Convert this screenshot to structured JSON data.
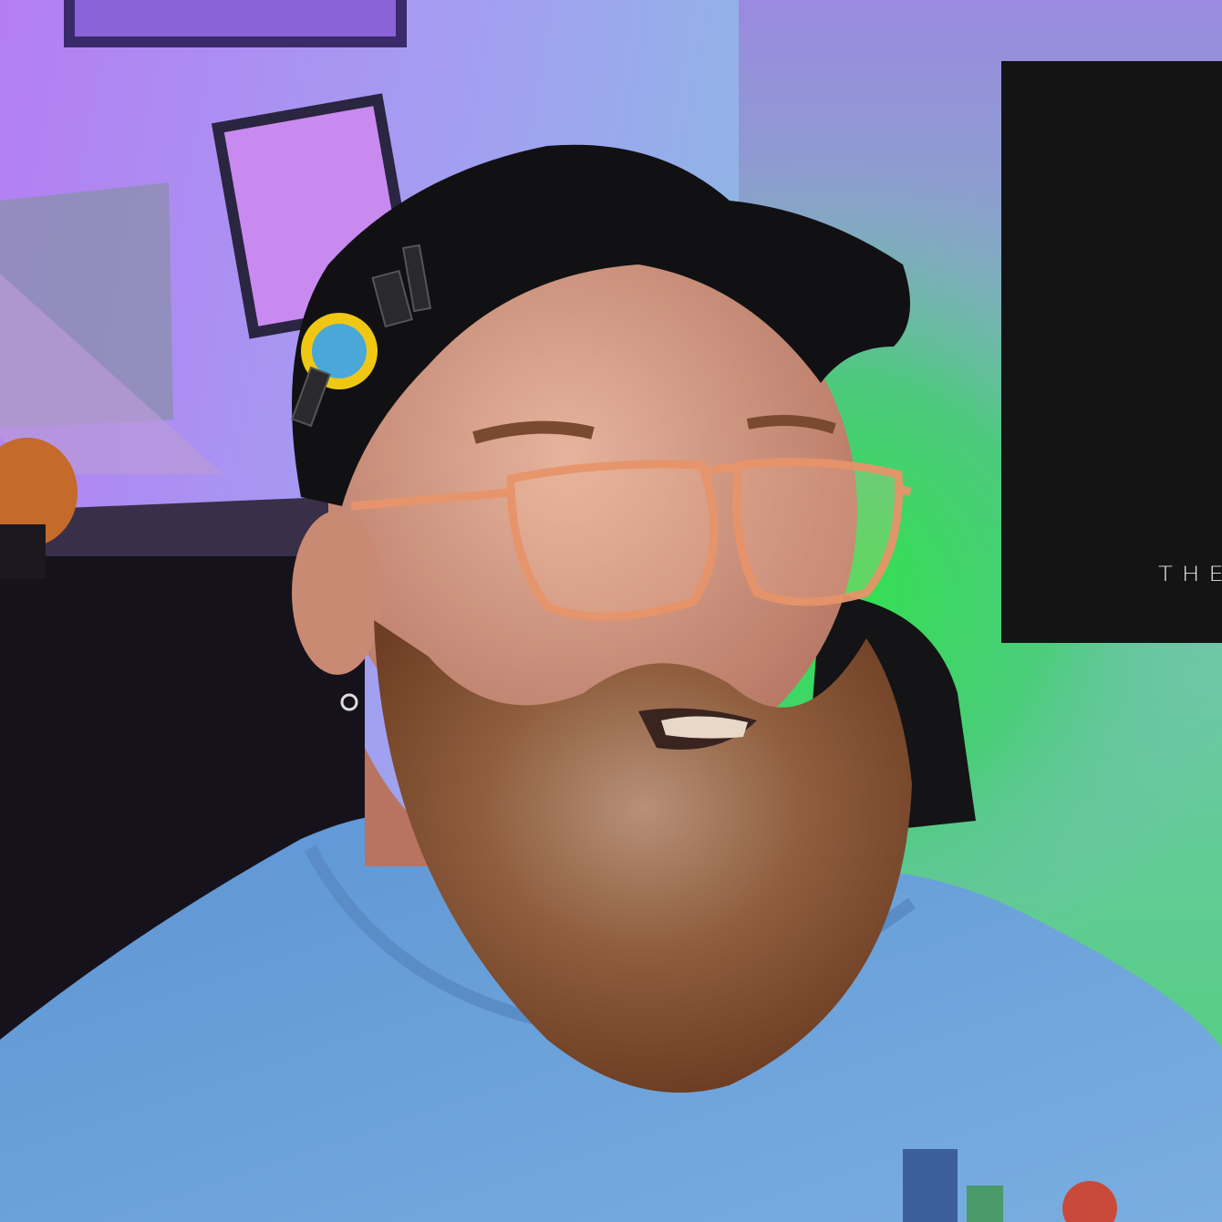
{
  "overlay": {
    "text": "THE"
  },
  "colors": {
    "wall_left": "#a98bf0",
    "wall_right": "#7fd9a0",
    "green_glow": "#2fe34a",
    "shirt": "#6a9fd6",
    "cap": "#111114",
    "beard": "#8a5a3a",
    "glasses": "#e8946a",
    "overlay_bg": "#141414"
  }
}
